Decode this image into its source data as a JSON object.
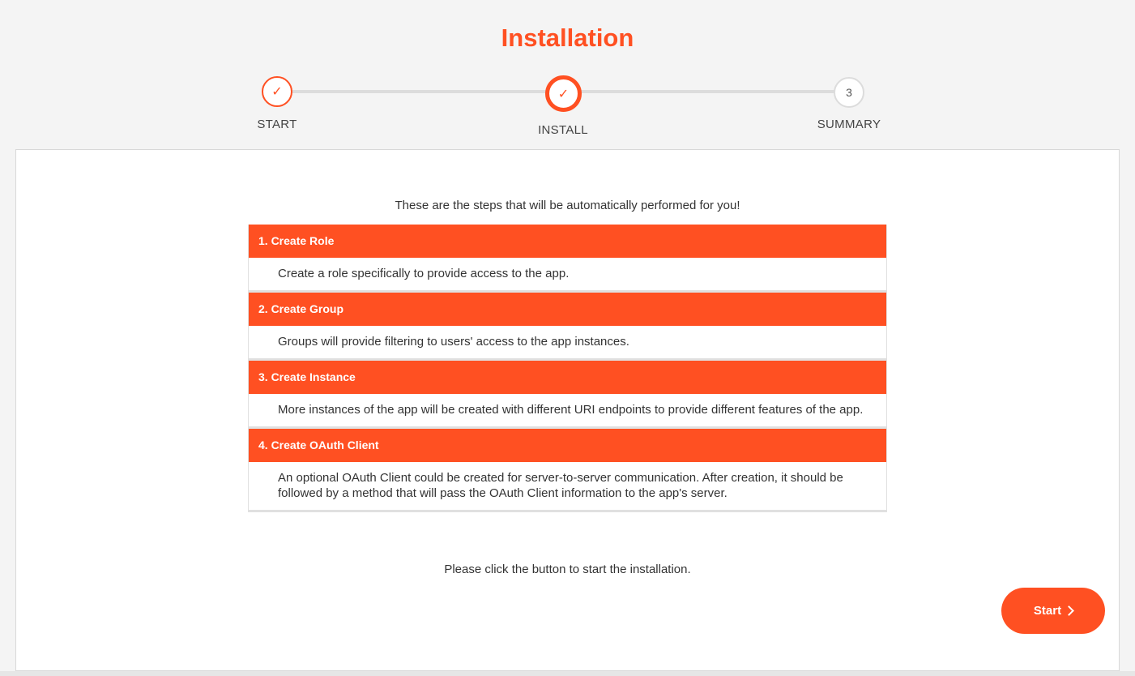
{
  "page": {
    "title": "Installation"
  },
  "stepper": {
    "steps": [
      {
        "label": "START",
        "state": "done",
        "symbol": "✓"
      },
      {
        "label": "INSTALL",
        "state": "current",
        "symbol": "✓"
      },
      {
        "label": "SUMMARY",
        "state": "pending",
        "symbol": "3"
      }
    ]
  },
  "content": {
    "intro": "These are the steps that will be automatically performed for you!",
    "steps": [
      {
        "title": "1. Create Role",
        "description": "Create a role specifically to provide access to the app."
      },
      {
        "title": "2. Create Group",
        "description": "Groups will provide filtering to users' access to the app instances."
      },
      {
        "title": "3. Create Instance",
        "description": "More instances of the app will be created with different URI endpoints to provide different features of the app."
      },
      {
        "title": "4. Create OAuth Client",
        "description": "An optional OAuth Client could be created for server-to-server communication. After creation, it should be followed by a method that will pass the OAuth Client information to the app's server."
      }
    ],
    "outro": "Please click the button to start the installation."
  },
  "actions": {
    "start_label": "Start",
    "start_icon": "chevron-right-icon"
  },
  "colors": {
    "accent": "#ff5022",
    "background": "#f4f4f4",
    "track": "#dcdcdc"
  }
}
